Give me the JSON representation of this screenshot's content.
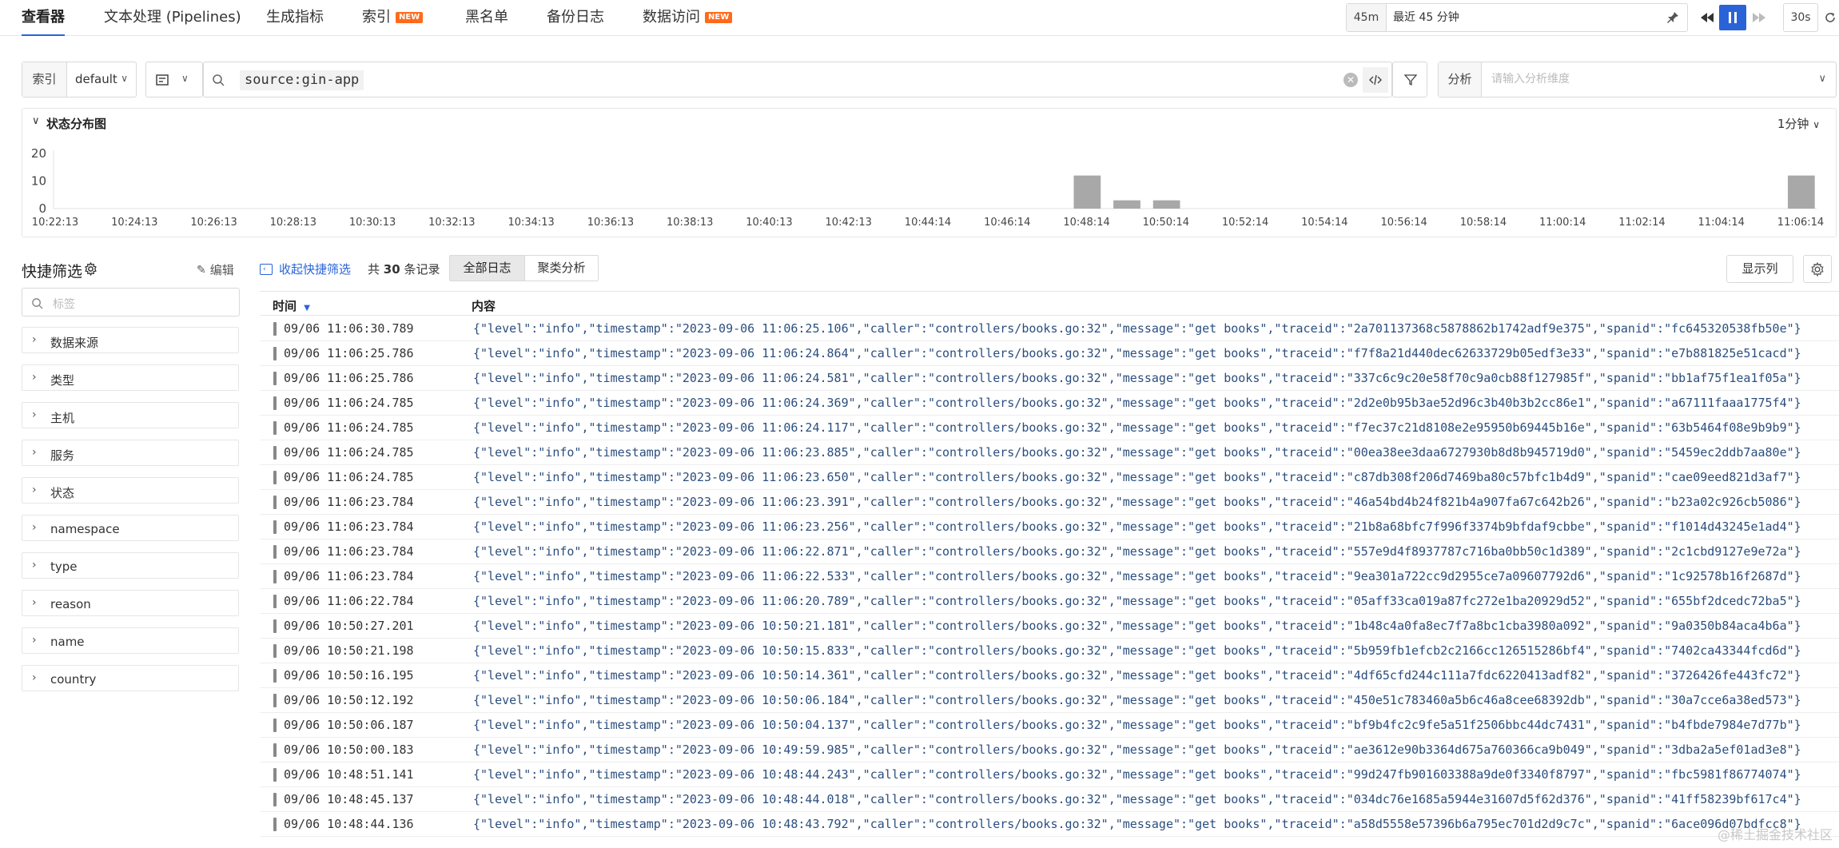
{
  "nav": {
    "tabs": [
      {
        "label": "查看器"
      },
      {
        "label": "文本处理 (Pipelines)"
      },
      {
        "label": "生成指标"
      },
      {
        "label": "索引",
        "badge": "NEW"
      },
      {
        "label": "黑名单"
      },
      {
        "label": "备份日志"
      },
      {
        "label": "数据访问",
        "badge": "NEW"
      }
    ],
    "time_short": "45m",
    "time_text": "最近 45 分钟",
    "refresh": "30s"
  },
  "query": {
    "index_label": "索引",
    "index_value": "default",
    "query_text": "source:gin-app",
    "analysis_label": "分析",
    "analysis_placeholder": "请输入分析维度"
  },
  "chart_section": {
    "title": "状态分布图",
    "interval": "1分钟"
  },
  "chart_data": {
    "type": "bar",
    "y_ticks": [
      "20",
      "10",
      "0"
    ],
    "ylim": [
      0,
      20
    ],
    "x_ticks": [
      "10:22:13",
      "10:24:13",
      "10:26:13",
      "10:28:13",
      "10:30:13",
      "10:32:13",
      "10:34:13",
      "10:36:13",
      "10:38:13",
      "10:40:13",
      "10:42:13",
      "10:44:14",
      "10:46:14",
      "10:48:14",
      "10:50:14",
      "10:52:14",
      "10:54:14",
      "10:56:14",
      "10:58:14",
      "11:00:14",
      "11:02:14",
      "11:04:14",
      "11:06:14"
    ],
    "bars": [
      {
        "x": "10:48:14",
        "value": 12
      },
      {
        "x": "10:49:14",
        "value": 3
      },
      {
        "x": "10:50:14",
        "value": 3
      },
      {
        "x": "11:06:14",
        "value": 12
      }
    ],
    "color": "#a8a8a8"
  },
  "filters": {
    "title": "快捷筛选",
    "edit_label": "编辑",
    "search_placeholder": "标签",
    "items": [
      "数据来源",
      "类型",
      "主机",
      "服务",
      "状态",
      "namespace",
      "type",
      "reason",
      "name",
      "country"
    ]
  },
  "toolbar": {
    "collapse_label": "收起快捷筛选",
    "count_prefix": "共",
    "count": "30",
    "count_suffix": "条记录",
    "view_all": "全部日志",
    "view_cluster": "聚类分析",
    "columns_button": "显示列"
  },
  "table": {
    "col_time": "时间",
    "col_content": "内容",
    "rows": [
      {
        "time": "09/06 11:06:30.789",
        "content": "{\"level\":\"info\",\"timestamp\":\"2023-09-06 11:06:25.106\",\"caller\":\"controllers/books.go:32\",\"message\":\"get books\",\"traceid\":\"2a701137368c5878862b1742adf9e375\",\"spanid\":\"fc645320538fb50e\"}"
      },
      {
        "time": "09/06 11:06:25.786",
        "content": "{\"level\":\"info\",\"timestamp\":\"2023-09-06 11:06:24.864\",\"caller\":\"controllers/books.go:32\",\"message\":\"get books\",\"traceid\":\"f7f8a21d440dec62633729b05edf3e33\",\"spanid\":\"e7b881825e51cacd\"}"
      },
      {
        "time": "09/06 11:06:25.786",
        "content": "{\"level\":\"info\",\"timestamp\":\"2023-09-06 11:06:24.581\",\"caller\":\"controllers/books.go:32\",\"message\":\"get books\",\"traceid\":\"337c6c9c20e58f70c9a0cb88f127985f\",\"spanid\":\"bb1af75f1ea1f05a\"}"
      },
      {
        "time": "09/06 11:06:24.785",
        "content": "{\"level\":\"info\",\"timestamp\":\"2023-09-06 11:06:24.369\",\"caller\":\"controllers/books.go:32\",\"message\":\"get books\",\"traceid\":\"2d2e0b95b3ae52d96c3b40b3b2cc86e1\",\"spanid\":\"a67111faaa1775f4\"}"
      },
      {
        "time": "09/06 11:06:24.785",
        "content": "{\"level\":\"info\",\"timestamp\":\"2023-09-06 11:06:24.117\",\"caller\":\"controllers/books.go:32\",\"message\":\"get books\",\"traceid\":\"f7ec37c21d8108e2e95950b69445b16e\",\"spanid\":\"63b5464f08e9b9b9\"}"
      },
      {
        "time": "09/06 11:06:24.785",
        "content": "{\"level\":\"info\",\"timestamp\":\"2023-09-06 11:06:23.885\",\"caller\":\"controllers/books.go:32\",\"message\":\"get books\",\"traceid\":\"00ea38ee3daa6727930b8d8b945719d0\",\"spanid\":\"5459ec2ddb7aa80e\"}"
      },
      {
        "time": "09/06 11:06:24.785",
        "content": "{\"level\":\"info\",\"timestamp\":\"2023-09-06 11:06:23.650\",\"caller\":\"controllers/books.go:32\",\"message\":\"get books\",\"traceid\":\"c87db308f206d7469ba80c57bfc1b4d9\",\"spanid\":\"cae09eed821d3af7\"}"
      },
      {
        "time": "09/06 11:06:23.784",
        "content": "{\"level\":\"info\",\"timestamp\":\"2023-09-06 11:06:23.391\",\"caller\":\"controllers/books.go:32\",\"message\":\"get books\",\"traceid\":\"46a54bd4b24f821b4a907fa67c642b26\",\"spanid\":\"b23a02c926cb5086\"}"
      },
      {
        "time": "09/06 11:06:23.784",
        "content": "{\"level\":\"info\",\"timestamp\":\"2023-09-06 11:06:23.256\",\"caller\":\"controllers/books.go:32\",\"message\":\"get books\",\"traceid\":\"21b8a68bfc7f996f3374b9bfdaf9cbbe\",\"spanid\":\"f1014d43245e1ad4\"}"
      },
      {
        "time": "09/06 11:06:23.784",
        "content": "{\"level\":\"info\",\"timestamp\":\"2023-09-06 11:06:22.871\",\"caller\":\"controllers/books.go:32\",\"message\":\"get books\",\"traceid\":\"557e9d4f8937787c716ba0bb50c1d389\",\"spanid\":\"2c1cbd9127e9e72a\"}"
      },
      {
        "time": "09/06 11:06:23.784",
        "content": "{\"level\":\"info\",\"timestamp\":\"2023-09-06 11:06:22.533\",\"caller\":\"controllers/books.go:32\",\"message\":\"get books\",\"traceid\":\"9ea301a722cc9d2955ce7a09607792d6\",\"spanid\":\"1c92578b16f2687d\"}"
      },
      {
        "time": "09/06 11:06:22.784",
        "content": "{\"level\":\"info\",\"timestamp\":\"2023-09-06 11:06:20.789\",\"caller\":\"controllers/books.go:32\",\"message\":\"get books\",\"traceid\":\"05aff33ca019a87fc272e1ba20929d52\",\"spanid\":\"655bf2dcedc72ba5\"}"
      },
      {
        "time": "09/06 10:50:27.201",
        "content": "{\"level\":\"info\",\"timestamp\":\"2023-09-06 10:50:21.181\",\"caller\":\"controllers/books.go:32\",\"message\":\"get books\",\"traceid\":\"1b48c4a0fa8ec7f7a8bc1cba3980a092\",\"spanid\":\"9a0350b84aca4b6a\"}"
      },
      {
        "time": "09/06 10:50:21.198",
        "content": "{\"level\":\"info\",\"timestamp\":\"2023-09-06 10:50:15.833\",\"caller\":\"controllers/books.go:32\",\"message\":\"get books\",\"traceid\":\"5b959fb1efcb2c2166cc126515286bf4\",\"spanid\":\"7402ca43344fcd6d\"}"
      },
      {
        "time": "09/06 10:50:16.195",
        "content": "{\"level\":\"info\",\"timestamp\":\"2023-09-06 10:50:14.361\",\"caller\":\"controllers/books.go:32\",\"message\":\"get books\",\"traceid\":\"4df65cfd244c111a7fdc6220413adf82\",\"spanid\":\"3726426fe443fc72\"}"
      },
      {
        "time": "09/06 10:50:12.192",
        "content": "{\"level\":\"info\",\"timestamp\":\"2023-09-06 10:50:06.184\",\"caller\":\"controllers/books.go:32\",\"message\":\"get books\",\"traceid\":\"450e51c783460a5b6c46a8cee68392db\",\"spanid\":\"30a7cce6a38ed573\"}"
      },
      {
        "time": "09/06 10:50:06.187",
        "content": "{\"level\":\"info\",\"timestamp\":\"2023-09-06 10:50:04.137\",\"caller\":\"controllers/books.go:32\",\"message\":\"get books\",\"traceid\":\"bf9b4fc2c9fe5a51f2506bbc44dc7431\",\"spanid\":\"b4fbde7984e7d77b\"}"
      },
      {
        "time": "09/06 10:50:00.183",
        "content": "{\"level\":\"info\",\"timestamp\":\"2023-09-06 10:49:59.985\",\"caller\":\"controllers/books.go:32\",\"message\":\"get books\",\"traceid\":\"ae3612e90b3364d675a760366ca9b049\",\"spanid\":\"3dba2a5ef01ad3e8\"}"
      },
      {
        "time": "09/06 10:48:51.141",
        "content": "{\"level\":\"info\",\"timestamp\":\"2023-09-06 10:48:44.243\",\"caller\":\"controllers/books.go:32\",\"message\":\"get books\",\"traceid\":\"99d247fb901603388a9de0f3340f8797\",\"spanid\":\"fbc5981f86774074\"}"
      },
      {
        "time": "09/06 10:48:45.137",
        "content": "{\"level\":\"info\",\"timestamp\":\"2023-09-06 10:48:44.018\",\"caller\":\"controllers/books.go:32\",\"message\":\"get books\",\"traceid\":\"034dc76e1685a5944e31607d5f62d376\",\"spanid\":\"41ff58239bf617c4\"}"
      },
      {
        "time": "09/06 10:48:44.136",
        "content": "{\"level\":\"info\",\"timestamp\":\"2023-09-06 10:48:43.792\",\"caller\":\"controllers/books.go:32\",\"message\":\"get books\",\"traceid\":\"a58d5558e57396b6a795ec701d2d9c7c\",\"spanid\":\"6ace096d07bdfcc8\"}"
      }
    ]
  },
  "watermark": "@稀土掘金技术社区",
  "colors": {
    "accent": "#2a63d8",
    "new_badge": "#ff6a1a",
    "log_text": "#2b4e7e",
    "bar": "#a8a8a8"
  }
}
